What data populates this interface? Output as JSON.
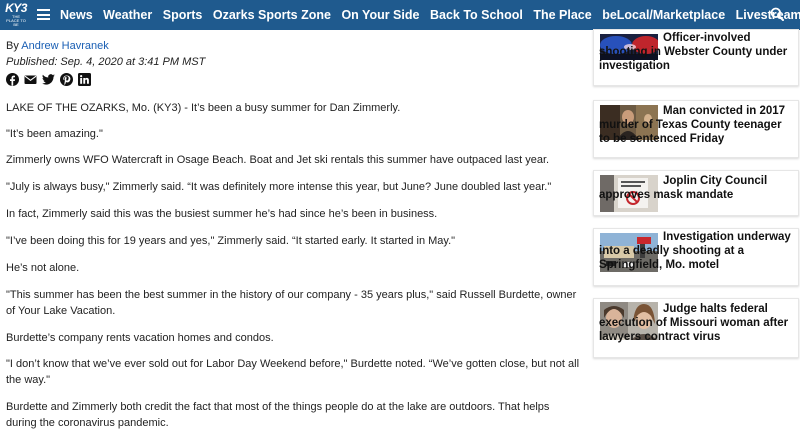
{
  "brand": {
    "logo_text": "KY3",
    "logo_sub": "THE PLACE TO BE"
  },
  "nav": {
    "items": [
      "News",
      "Weather",
      "Sports",
      "Ozarks Sports Zone",
      "On Your Side",
      "Back To School",
      "The Place",
      "beLocal/Marketplace",
      "Livestream"
    ]
  },
  "article": {
    "byline_prefix": "By ",
    "author": "Andrew Havranek",
    "published": "Published: Sep. 4, 2020 at 3:41 PM MST",
    "share_icons": [
      "facebook-icon",
      "email-icon",
      "twitter-icon",
      "pinterest-icon",
      "linkedin-icon"
    ],
    "paragraphs": [
      "LAKE OF THE OZARKS, Mo. (KY3) - It’s been a busy summer for Dan Zimmerly.",
      "\"It’s been amazing.\"",
      "Zimmerly owns WFO Watercraft in Osage Beach. Boat and Jet ski rentals this summer have outpaced last year.",
      "\"July is always busy,\" Zimmerly said. “It was definitely more intense this year, but June? June doubled last year.\"",
      "In fact, Zimmerly said this was the busiest summer he’s had since he’s been in business.",
      "\"I’ve been doing this for 19 years and yes,\" Zimmerly said. “It started early. It started in May.\"",
      "He’s not alone.",
      "\"This summer has been the best summer in the history of our company - 35 years plus,\" said Russell Burdette, owner of Your Lake Vacation.",
      "Burdette’s company rents vacation homes and condos.",
      "\"I don’t know that we’ve ever sold out for Labor Day Weekend before,\" Burdette noted. “We’ve gotten close, but not all the way.\"",
      "Burdette and Zimmerly both credit the fact that most of the things people do at the lake are outdoors. That helps during the coronavirus pandemic."
    ]
  },
  "sidebar": {
    "cards": [
      {
        "title": "Officer-involved shooting in Webster County under investigation"
      },
      {
        "title": "Man convicted in 2017 murder of Texas County teenager to be sentenced Friday"
      },
      {
        "title": "Joplin City Council approves mask mandate"
      },
      {
        "title": "Investigation underway into a deadly shooting at a Springfield, Mo. motel"
      },
      {
        "title": "Judge halts federal execution of Missouri woman after lawyers contract virus"
      }
    ]
  },
  "colors": {
    "nav_bg": "#1f5a8e",
    "link": "#1a5fb4"
  }
}
